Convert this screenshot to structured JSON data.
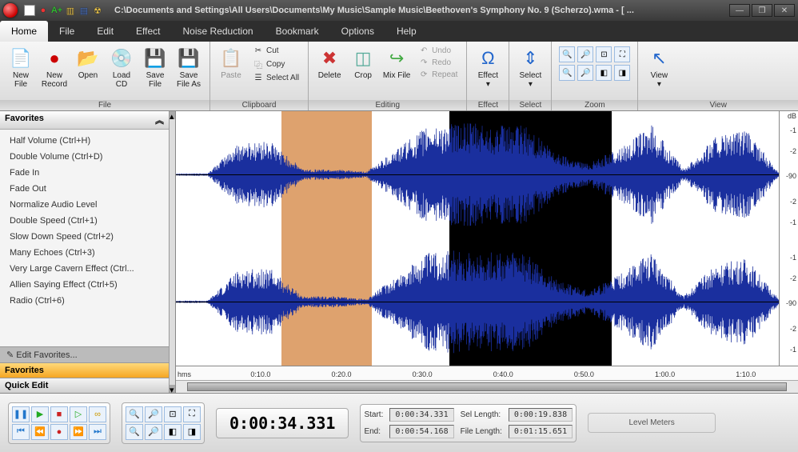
{
  "title": "C:\\Documents and Settings\\All Users\\Documents\\My Music\\Sample Music\\Beethoven's Symphony No. 9 (Scherzo).wma - [ ...",
  "menus": [
    "Home",
    "File",
    "Edit",
    "Effect",
    "Noise Reduction",
    "Bookmark",
    "Options",
    "Help"
  ],
  "active_menu": "Home",
  "ribbon": {
    "file": {
      "label": "File",
      "buttons": [
        {
          "id": "new-file",
          "label": "New\nFile"
        },
        {
          "id": "new-record",
          "label": "New\nRecord"
        },
        {
          "id": "open",
          "label": "Open"
        },
        {
          "id": "load-cd",
          "label": "Load\nCD"
        },
        {
          "id": "save-file",
          "label": "Save\nFile"
        },
        {
          "id": "save-file-as",
          "label": "Save\nFile As"
        }
      ]
    },
    "clipboard": {
      "label": "Clipboard",
      "paste": "Paste",
      "cut": "Cut",
      "copy": "Copy",
      "select_all": "Select All"
    },
    "editing": {
      "label": "Editing",
      "delete": "Delete",
      "crop": "Crop",
      "mix": "Mix\nFile",
      "undo": "Undo",
      "redo": "Redo",
      "repeat": "Repeat"
    },
    "effect": {
      "label": "Effect",
      "btn": "Effect"
    },
    "select": {
      "label": "Select",
      "btn": "Select"
    },
    "zoom": {
      "label": "Zoom"
    },
    "view": {
      "label": "View",
      "btn": "View"
    }
  },
  "sidebar": {
    "title": "Favorites",
    "items": [
      "Half Volume (Ctrl+H)",
      "Double Volume (Ctrl+D)",
      "Fade In",
      "Fade Out",
      "Normalize Audio Level",
      "Double Speed (Ctrl+1)",
      "Slow Down Speed (Ctrl+2)",
      "Many Echoes (Ctrl+3)",
      "Very Large Cavern Effect (Ctrl...",
      "Allien Saying Effect (Ctrl+5)",
      "Radio (Ctrl+6)"
    ],
    "edit": "Edit Favorites...",
    "tab_fav": "Favorites",
    "tab_quick": "Quick Edit"
  },
  "timeline": {
    "unit": "hms",
    "ticks": [
      "0:10.0",
      "0:20.0",
      "0:30.0",
      "0:40.0",
      "0:50.0",
      "1:00.0",
      "1:10.0"
    ]
  },
  "db_scale": [
    "dB",
    "-1",
    "-2",
    "-90",
    "-2",
    "-1"
  ],
  "timecode": "0:00:34.331",
  "info": {
    "start_l": "Start:",
    "start_v": "0:00:34.331",
    "sel_l": "Sel Length:",
    "sel_v": "0:00:19.838",
    "end_l": "End:",
    "end_v": "0:00:54.168",
    "file_l": "File Length:",
    "file_v": "0:01:15.651"
  },
  "meters_label": "Level Meters",
  "selection": {
    "orange_start_pct": 17.0,
    "orange_end_pct": 31.5,
    "black_start_pct": 44.0,
    "black_end_pct": 70.0
  }
}
